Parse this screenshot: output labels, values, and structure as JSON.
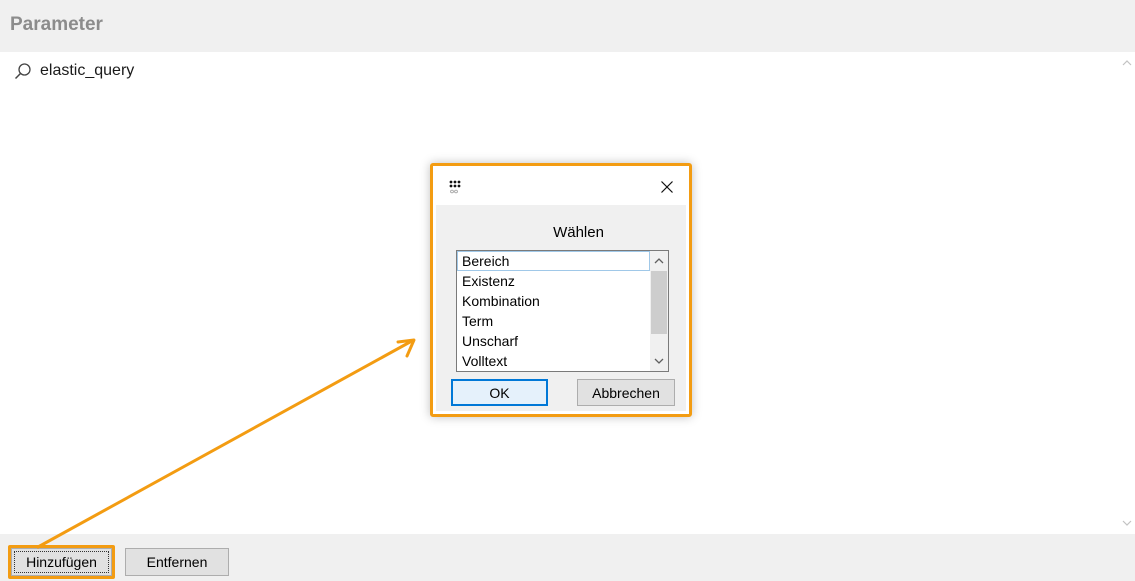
{
  "header": {
    "title": "Parameter"
  },
  "tree": {
    "item_label": "elastic_query",
    "item_icon": "search-icon"
  },
  "footer": {
    "add_label": "Hinzufügen",
    "remove_label": "Entfernen"
  },
  "dialog": {
    "prompt": "Wählen",
    "options": [
      "Bereich",
      "Existenz",
      "Kombination",
      "Term",
      "Unscharf",
      "Volltext"
    ],
    "ok_label": "OK",
    "cancel_label": "Abbrechen",
    "close_icon": "close-icon",
    "app_icon": "dots-grid-icon"
  },
  "colors": {
    "highlight": "#f39c12",
    "ok_border": "#0078d7",
    "header_text": "#8c8c8c"
  }
}
